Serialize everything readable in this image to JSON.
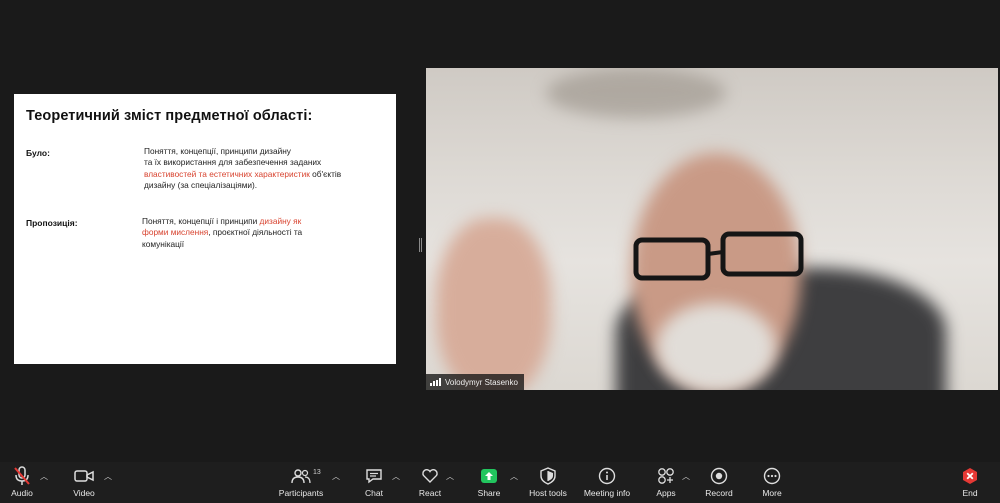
{
  "slide": {
    "title": "Теоретичний зміст предметної області:",
    "row1": {
      "label": "Було:",
      "line1": "Поняття, концепції, принципи дизайну",
      "line2": "та їх використання для забезпечення заданих",
      "line3_accent": "властивостей та естетичних характеристик",
      "line3_rest": " об'єктів",
      "line4": "дизайну (за спеціалізаціями)."
    },
    "row2": {
      "label": "Пропозиція:",
      "line1_pre": "Поняття, концепції і принципи ",
      "line1_accent": "дизайну як",
      "line2_accent": "форми мислення",
      "line2_rest": ", проєктної діяльності та",
      "line3": "комунікації"
    }
  },
  "video": {
    "participant_name": "Volodymyr Stasenko"
  },
  "toolbar": {
    "audio": "Audio",
    "video": "Video",
    "participants": "Participants",
    "participants_count": "13",
    "chat": "Chat",
    "react": "React",
    "share": "Share",
    "host_tools": "Host tools",
    "meeting_info": "Meeting info",
    "apps": "Apps",
    "record": "Record",
    "more": "More",
    "end": "End"
  },
  "colors": {
    "accent": "#d8432f",
    "share_green": "#22c55e",
    "end_red": "#e53935",
    "muted_red": "#e53935"
  }
}
